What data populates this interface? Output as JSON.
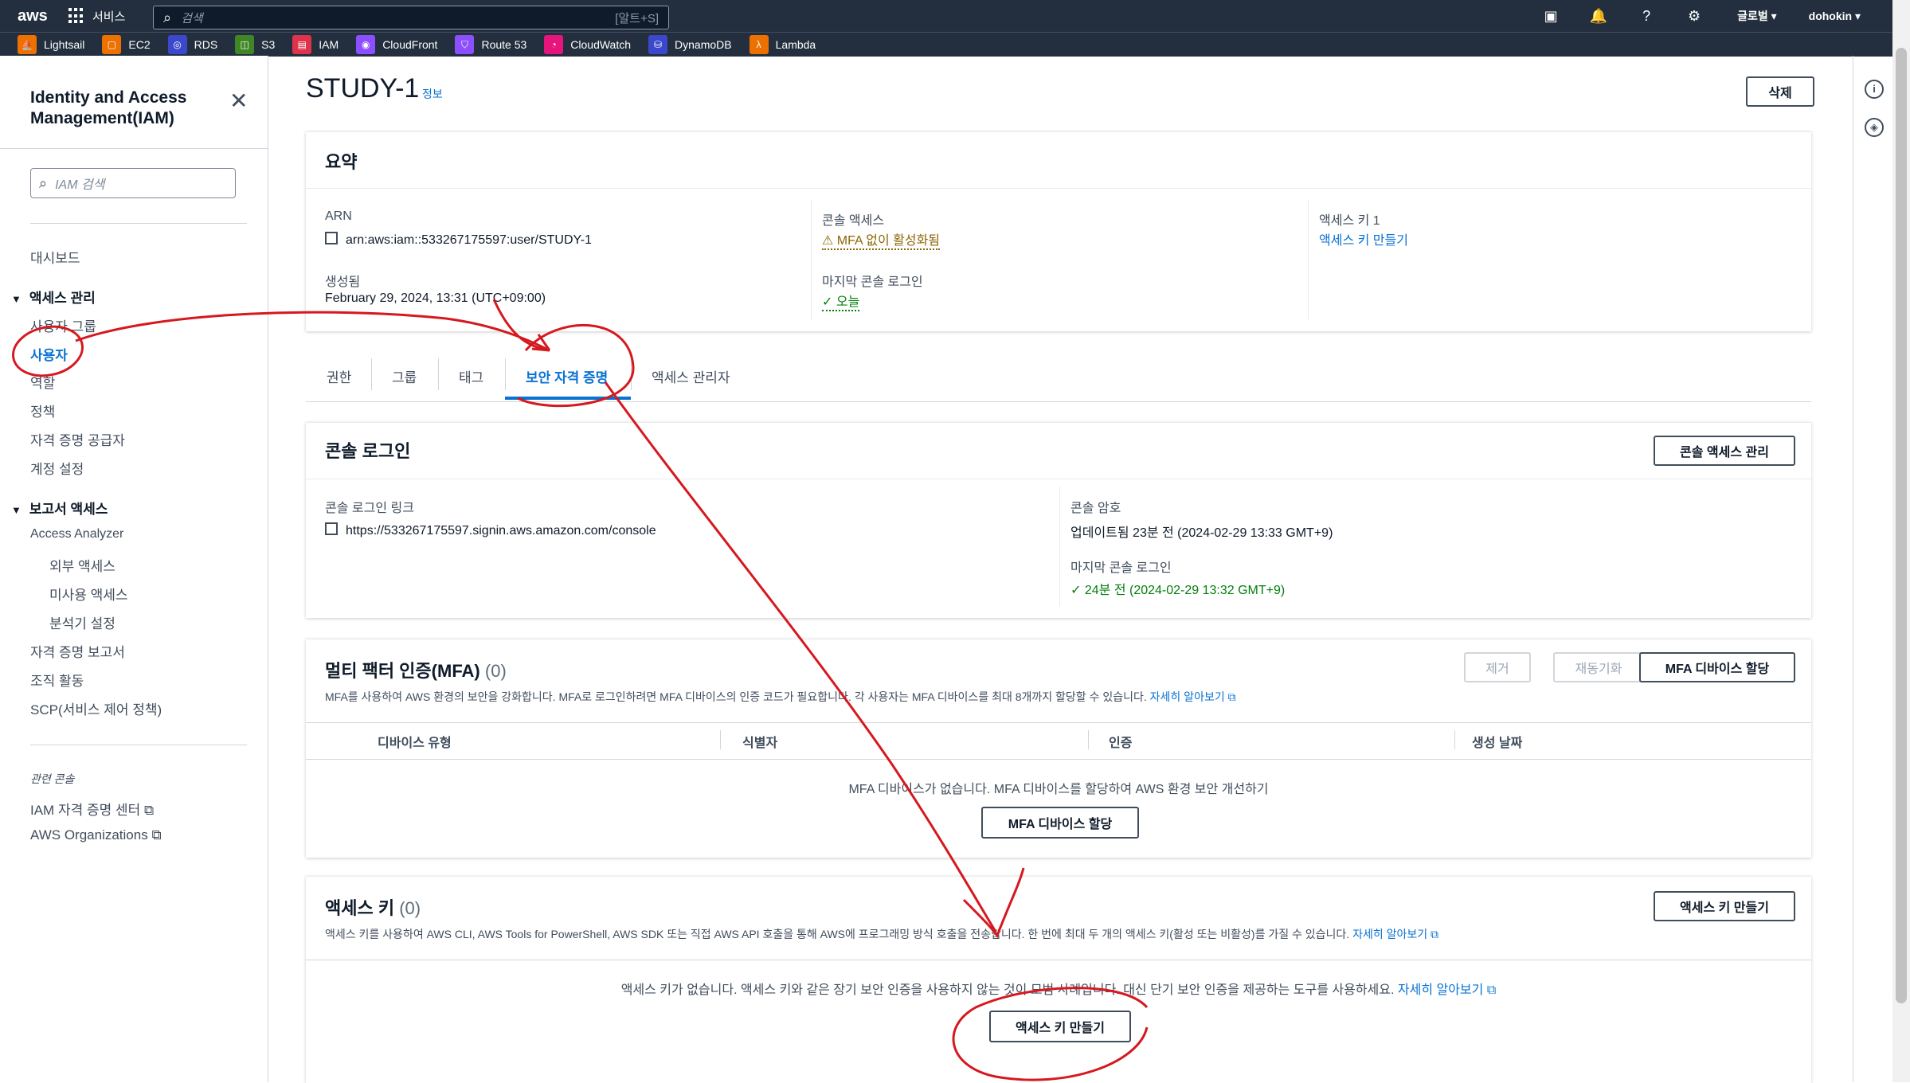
{
  "topbar": {
    "logo": "aws",
    "services_label": "서비스",
    "search_placeholder": "검색",
    "search_shortcut": "[알트+S]",
    "region": "글로벌 ▾",
    "user": "dohokin ▾"
  },
  "favorites": [
    {
      "label": "Lightsail",
      "color": "#ed7100"
    },
    {
      "label": "EC2",
      "color": "#ed7100"
    },
    {
      "label": "RDS",
      "color": "#3b48cc"
    },
    {
      "label": "S3",
      "color": "#3f8624"
    },
    {
      "label": "IAM",
      "color": "#dd344c"
    },
    {
      "label": "CloudFront",
      "color": "#8c4fff"
    },
    {
      "label": "Route 53",
      "color": "#8c4fff"
    },
    {
      "label": "CloudWatch",
      "color": "#e7157b"
    },
    {
      "label": "DynamoDB",
      "color": "#3b48cc"
    },
    {
      "label": "Lambda",
      "color": "#ed7100"
    }
  ],
  "sidebar": {
    "title": "Identity and Access Management(IAM)",
    "search_placeholder": "IAM 검색",
    "dashboard": "대시보드",
    "access_mgmt": "액세스 관리",
    "user_groups": "사용자 그룹",
    "users": "사용자",
    "roles": "역할",
    "policies": "정책",
    "id_providers": "자격 증명 공급자",
    "account_settings": "계정 설정",
    "access_reports": "보고서 액세스",
    "access_analyzer": "Access Analyzer",
    "external_access": "외부 액세스",
    "unused_access": "미사용 액세스",
    "analyzer_settings": "분석기 설정",
    "credential_report": "자격 증명 보고서",
    "org_activity": "조직 활동",
    "scp": "SCP(서비스 제어 정책)",
    "related_consoles": "관련 콘솔",
    "iam_identity_center": "IAM 자격 증명 센터",
    "aws_organizations": "AWS Organizations"
  },
  "page": {
    "title": "STUDY-1",
    "info": "정보",
    "delete": "삭제"
  },
  "summary": {
    "heading": "요약",
    "arn_label": "ARN",
    "arn_value": "arn:aws:iam::533267175597:user/STUDY-1",
    "created_label": "생성됨",
    "created_value": "February 29, 2024, 13:31 (UTC+09:00)",
    "console_access_label": "콘솔 액세스",
    "console_access_value": "MFA 없이 활성화됨",
    "last_login_label": "마지막 콘솔 로그인",
    "last_login_value": "오늘",
    "access_key_label": "액세스 키 1",
    "access_key_link": "액세스 키 만들기"
  },
  "tabs": [
    "권한",
    "그룹",
    "태그",
    "보안 자격 증명",
    "액세스 관리자"
  ],
  "console_login": {
    "heading": "콘솔 로그인",
    "manage_button": "콘솔 액세스 관리",
    "link_label": "콘솔 로그인 링크",
    "link_value": "https://533267175597.signin.aws.amazon.com/console",
    "password_label": "콘솔 암호",
    "password_value": "업데이트됨 23분 전 (2024-02-29 13:33 GMT+9)",
    "last_login_label": "마지막 콘솔 로그인",
    "last_login_value": "24분 전 (2024-02-29 13:32 GMT+9)"
  },
  "mfa": {
    "heading": "멀티 팩터 인증(MFA)",
    "count": "(0)",
    "remove": "제거",
    "resync": "재동기화",
    "assign": "MFA 디바이스 할당",
    "description": "MFA를 사용하여 AWS 환경의 보안을 강화합니다. MFA로 로그인하려면 MFA 디바이스의 인증 코드가 필요합니다. 각 사용자는 MFA 디바이스를 최대 8개까지 할당할 수 있습니다.",
    "learn_more": "자세히 알아보기",
    "columns": [
      "디바이스 유형",
      "식별자",
      "인증",
      "생성 날짜"
    ],
    "empty": "MFA 디바이스가 없습니다. MFA 디바이스를 할당하여 AWS 환경 보안 개선하기",
    "assign_center": "MFA 디바이스 할당"
  },
  "access_keys": {
    "heading": "액세스 키",
    "count": "(0)",
    "create": "액세스 키 만들기",
    "description": "액세스 키를 사용하여 AWS CLI, AWS Tools for PowerShell, AWS SDK 또는 직접 AWS API 호출을 통해 AWS에 프로그래밍 방식 호출을 전송합니다. 한 번에 최대 두 개의 액세스 키(활성 또는 비활성)를 가질 수 있습니다.",
    "learn_more": "자세히 알아보기",
    "empty": "액세스 키가 없습니다. 액세스 키와 같은 장기 보안 인증을 사용하지 않는 것이 모범 사례입니다. 대신 단기 보안 인증을 제공하는 도구를 사용하세요.",
    "empty_link": "자세히 알아보기",
    "create_center": "액세스 키 만들기"
  },
  "colors": {
    "accent": "#0972d3",
    "nav_bg": "#232f3e",
    "annotation": "#d6181f"
  }
}
